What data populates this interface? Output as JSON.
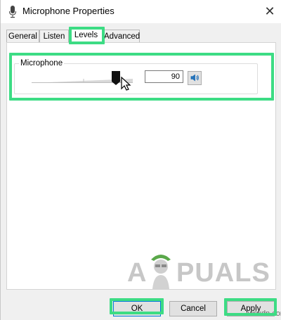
{
  "window": {
    "title": "Microphone Properties",
    "close_glyph": "✕"
  },
  "tabs": [
    {
      "label": "General",
      "active": false
    },
    {
      "label": "Listen",
      "active": false
    },
    {
      "label": "Levels",
      "active": true
    },
    {
      "label": "Advanced",
      "active": false
    }
  ],
  "levels": {
    "group_label": "Microphone",
    "level_value": "90",
    "slider_level_fraction": 0.9
  },
  "buttons": {
    "ok": "OK",
    "cancel": "Cancel",
    "apply": "Apply"
  },
  "watermark": {
    "text": "PUALS",
    "prefix": "A"
  },
  "footer": {
    "site": "wsxdn.com"
  },
  "colors": {
    "highlight": "#3ddc84",
    "accent": "#0078d7"
  },
  "icons": {
    "title": "microphone-icon",
    "mute": "speaker-icon",
    "close": "close-icon",
    "cursor": "mouse-pointer-icon"
  }
}
